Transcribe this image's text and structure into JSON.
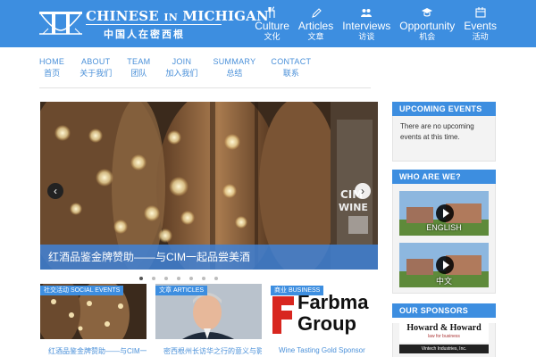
{
  "site": {
    "logo_text": "CHINESE",
    "logo_text_small": "IN",
    "logo_text_2": "MICHIGAN",
    "logo_sub": "中国人在密西根"
  },
  "mainnav": [
    {
      "label": "Culture",
      "label_zh": "文化",
      "icon": "fork-knife-icon"
    },
    {
      "label": "Articles",
      "label_zh": "文章",
      "icon": "pencil-icon"
    },
    {
      "label": "Interviews",
      "label_zh": "访谈",
      "icon": "people-icon"
    },
    {
      "label": "Opportunity",
      "label_zh": "机会",
      "icon": "graduation-cap-icon"
    },
    {
      "label": "Events",
      "label_zh": "活动",
      "icon": "calendar-icon"
    }
  ],
  "subnav": [
    {
      "label": "HOME",
      "label_zh": "首页"
    },
    {
      "label": "ABOUT",
      "label_zh": "关于我们"
    },
    {
      "label": "TEAM",
      "label_zh": "团队"
    },
    {
      "label": "JOIN",
      "label_zh": "加入我们"
    },
    {
      "label": "SUMMARY",
      "label_zh": "总结"
    },
    {
      "label": "CONTACT",
      "label_zh": "联系"
    }
  ],
  "slider": {
    "caption": "红酒品鉴金牌赞助——与CIM一起品尝美酒",
    "prev": "‹",
    "next": "›",
    "dots_count": 7,
    "active_dot": 0,
    "watermark": "CIM WINE 品酒"
  },
  "cards": [
    {
      "tag": "社交活动 SOCIAL EVENTS",
      "title": "红酒品鉴金牌赞助——与CIM一起品尝"
    },
    {
      "tag": "文章 ARTICLES",
      "title": "密西根州长访华之行的意义与影响"
    },
    {
      "tag": "商业 BUSINESS",
      "title": "Wine Tasting Gold Sponsor",
      "thumb_text_1": "Farbma",
      "thumb_text_2": "Group"
    }
  ],
  "sidebar": {
    "upcoming": {
      "title": "UPCOMING EVENTS",
      "text": "There are no upcoming events at this time."
    },
    "who": {
      "title": "WHO ARE WE?",
      "videos": [
        {
          "label": "ENGLISH"
        },
        {
          "label": "中文"
        }
      ]
    },
    "sponsors": {
      "title": "OUR SPONSORS",
      "sponsor1": "Howard & Howard",
      "sponsor1_tag": "law for business",
      "sponsor2": "Vintech Industries, Inc."
    }
  },
  "colors": {
    "brand": "#3d8ee0",
    "link": "#4a90d9"
  }
}
